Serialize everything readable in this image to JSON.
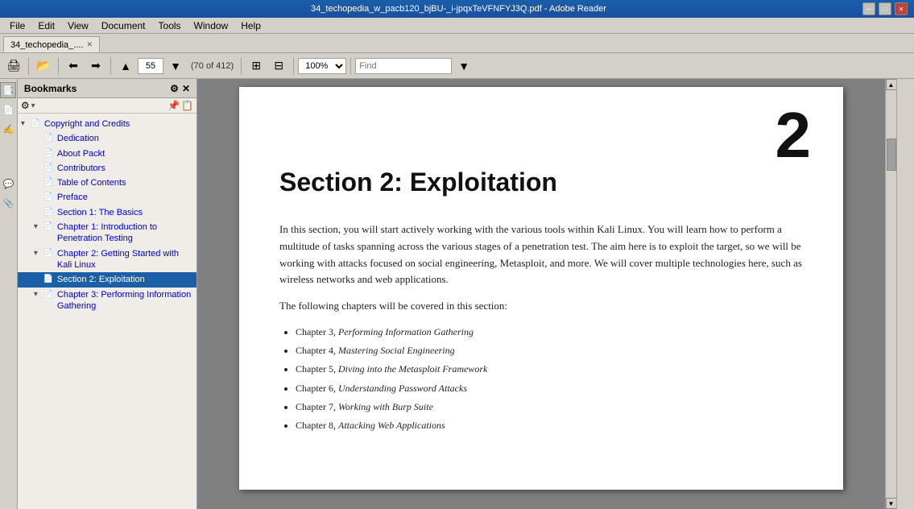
{
  "titlebar": {
    "title": "34_techopedia_w_pacb120_bjBU-_i-jpqxTeVFNFYJ3Q.pdf - Adobe Reader",
    "minimize": "─",
    "maximize": "□",
    "close": "✕"
  },
  "menubar": {
    "items": [
      "File",
      "Edit",
      "View",
      "Document",
      "Tools",
      "Window",
      "Help"
    ]
  },
  "tab": {
    "label": "34_techopedia_....",
    "close": "✕"
  },
  "toolbar": {
    "page_number": "55",
    "page_info": "(70 of 412)",
    "zoom": "100%",
    "find_placeholder": "Find"
  },
  "panel": {
    "title": "Bookmarks"
  },
  "bookmarks": [
    {
      "id": "copyright",
      "label": "Copyright and Credits",
      "indent": 0,
      "expanded": true,
      "type": "doc"
    },
    {
      "id": "dedication",
      "label": "Dedication",
      "indent": 1,
      "type": "doc"
    },
    {
      "id": "about",
      "label": "About Packt",
      "indent": 1,
      "type": "doc"
    },
    {
      "id": "contributors",
      "label": "Contributors",
      "indent": 1,
      "type": "doc"
    },
    {
      "id": "toc",
      "label": "Table of Contents",
      "indent": 1,
      "type": "doc"
    },
    {
      "id": "preface",
      "label": "Preface",
      "indent": 1,
      "type": "doc"
    },
    {
      "id": "section1",
      "label": "Section 1: The Basics",
      "indent": 1,
      "type": "doc"
    },
    {
      "id": "chapter1",
      "label": "Chapter 1: Introduction to Penetration Testing",
      "indent": 1,
      "expanded": true,
      "type": "doc",
      "hasExpander": true
    },
    {
      "id": "chapter2",
      "label": "Chapter 2: Getting Started with Kali Linux",
      "indent": 1,
      "expanded": true,
      "type": "doc",
      "hasExpander": true
    },
    {
      "id": "section2",
      "label": "Section 2: Exploitation",
      "indent": 1,
      "type": "doc",
      "selected": true
    },
    {
      "id": "chapter3",
      "label": "Chapter 3: Performing Information Gathering",
      "indent": 1,
      "expanded": true,
      "type": "doc",
      "hasExpander": true
    }
  ],
  "pdf": {
    "page_number": "2",
    "section_title": "Section 2: Exploitation",
    "body_text_1": "In this section, you will start actively working with the various tools within Kali Linux. You will learn how to perform a multitude of tasks spanning across the various stages of a penetration test. The aim here is to exploit the target, so we will be working with attacks focused on social engineering, Metasploit, and more. We will cover multiple technologies here, such as wireless networks and web applications.",
    "body_text_2": "The following chapters will be covered in this section:",
    "chapters": [
      {
        "prefix": "Chapter 3,",
        "italic": "Performing Information Gathering"
      },
      {
        "prefix": "Chapter 4,",
        "italic": "Mastering Social Engineering"
      },
      {
        "prefix": "Chapter 5,",
        "italic": "Diving into the Metasploit Framework"
      },
      {
        "prefix": "Chapter 6,",
        "italic": "Understanding Password Attacks"
      },
      {
        "prefix": "Chapter 7,",
        "italic": "Working with Burp Suite"
      },
      {
        "prefix": "Chapter 8,",
        "italic": "Attacking Web Applications"
      }
    ]
  }
}
